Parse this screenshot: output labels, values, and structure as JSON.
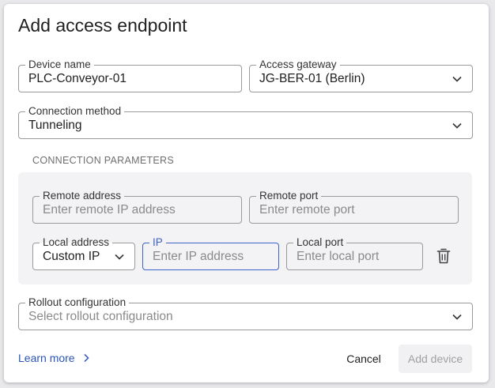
{
  "dialog": {
    "title": "Add access endpoint"
  },
  "fields": {
    "device_name": {
      "label": "Device name",
      "value": "PLC-Conveyor-01"
    },
    "access_gateway": {
      "label": "Access gateway",
      "value": "JG-BER-01 (Berlin)"
    },
    "connection_method": {
      "label": "Connection method",
      "value": "Tunneling"
    }
  },
  "connection_parameters": {
    "title": "CONNECTION PARAMETERS",
    "remote_address": {
      "label": "Remote address",
      "placeholder": "Enter remote IP address"
    },
    "remote_port": {
      "label": "Remote port",
      "placeholder": "Enter remote port"
    },
    "local_address": {
      "label": "Local address",
      "value": "Custom IP"
    },
    "ip": {
      "label": "IP",
      "placeholder": "Enter IP address"
    },
    "local_port": {
      "label": "Local port",
      "placeholder": "Enter local port"
    },
    "delete_icon": "trash-icon"
  },
  "rollout": {
    "label": "Rollout configuration",
    "placeholder": "Select rollout configuration"
  },
  "footer": {
    "learn_more": "Learn more",
    "cancel": "Cancel",
    "add_device": "Add device"
  },
  "colors": {
    "accent": "#3d63c9",
    "link": "#2b55b8",
    "disabled_bg": "#f1f1f3",
    "disabled_text": "#a0a0a0"
  }
}
